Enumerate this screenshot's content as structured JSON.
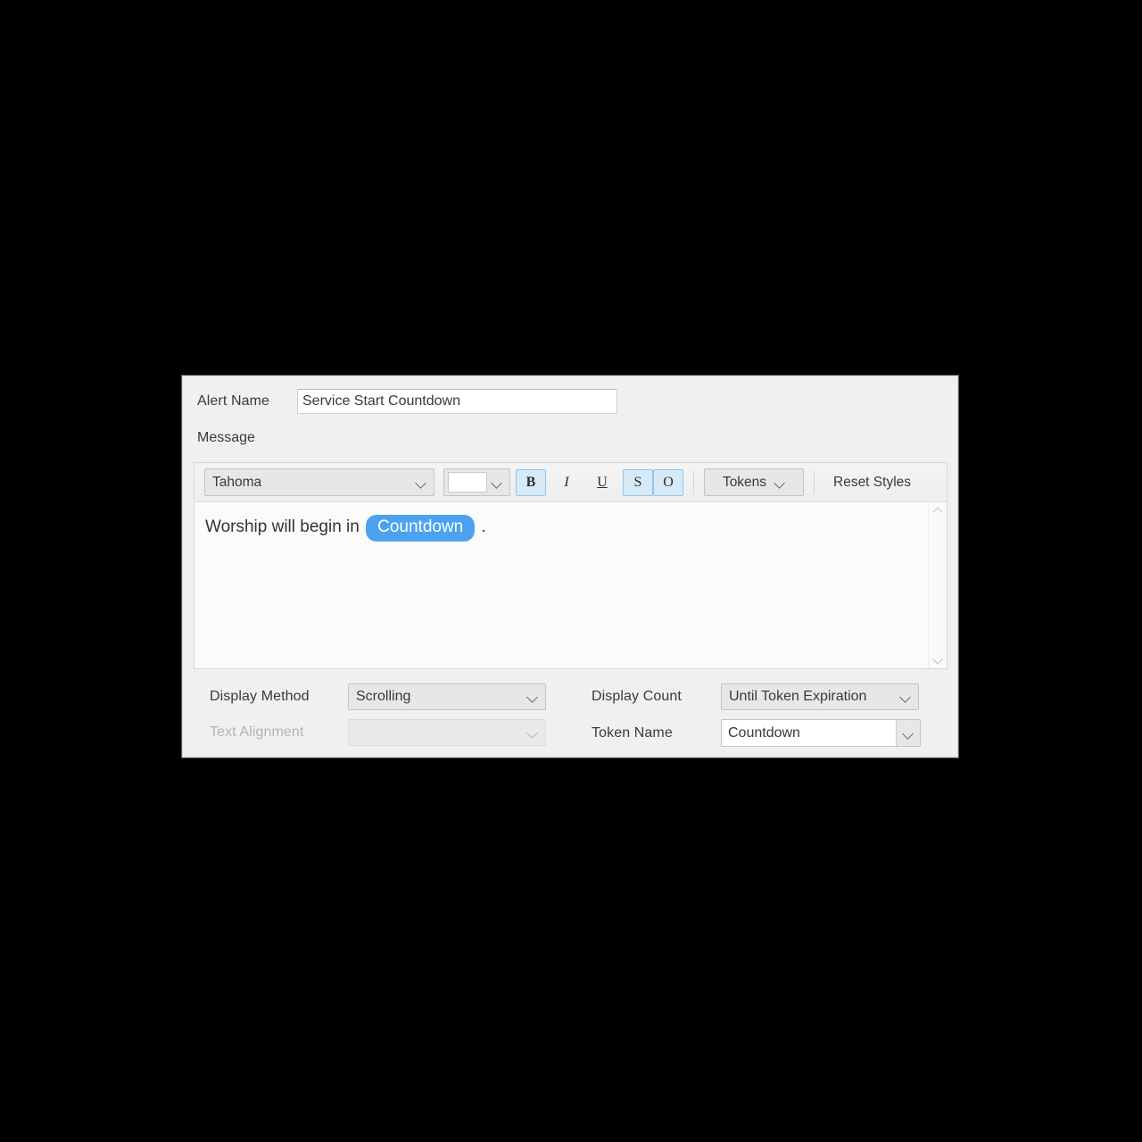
{
  "dialog": {
    "alert_name": {
      "label": "Alert Name",
      "value": "Service Start Countdown"
    },
    "message": {
      "label": "Message",
      "toolbar": {
        "font_family": "Tahoma",
        "text_color": "#ffffff",
        "bold_label": "B",
        "italic_label": "I",
        "underline_label": "U",
        "shadow_label": "S",
        "outline_label": "O",
        "tokens_label": "Tokens",
        "reset_styles_label": "Reset Styles"
      },
      "body_prefix": "Worship will begin in",
      "body_token": "Countdown",
      "body_suffix": "."
    },
    "display_method": {
      "label": "Display Method",
      "value": "Scrolling"
    },
    "text_alignment": {
      "label": "Text Alignment",
      "value": "",
      "disabled": true
    },
    "display_count": {
      "label": "Display Count",
      "value": "Until Token Expiration"
    },
    "token_name": {
      "label": "Token Name",
      "value": "Countdown"
    },
    "colors": {
      "accent_token": "#4da2f0",
      "active_button_bg": "#d6e9f9",
      "active_button_border": "#97c5e8",
      "panel_bg": "#f0f0f0"
    }
  }
}
